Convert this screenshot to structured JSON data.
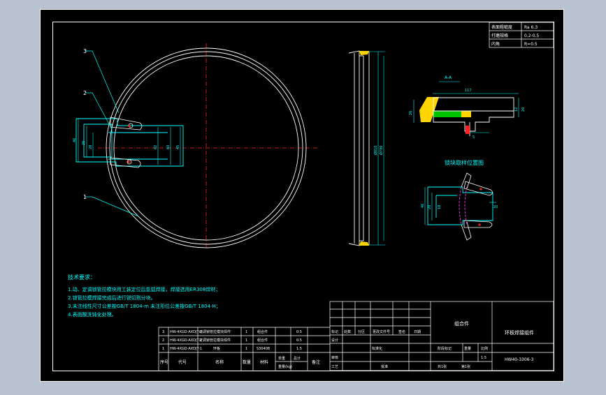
{
  "roughness_table": {
    "rows": [
      [
        "表面粗糙度",
        "Ra 6.3"
      ],
      [
        "打磨规格",
        "0.2-0.5"
      ],
      [
        "内角",
        "R=0.5"
      ]
    ]
  },
  "front_view": {
    "part_labels": [
      "3",
      "2",
      "1"
    ],
    "dimension_labels": [
      "46",
      "26",
      "28",
      "62",
      "60",
      "45"
    ]
  },
  "side_view": {
    "dimension_labels": [
      "Ø810",
      "Ø790"
    ]
  },
  "section": {
    "title": "A-A",
    "dimension_labels": [
      "117",
      "26",
      "12",
      "5",
      "20"
    ]
  },
  "block_view": {
    "title": "锁块取样位置图",
    "dimension_labels": [
      "46",
      "28",
      "18",
      "20"
    ]
  },
  "notes": {
    "heading": "技术要求：",
    "lines": [
      "1.动、定调锁管拉模块用工装定位后氩弧焊接，焊接选用ER308焊材；",
      "2.锁管拉模焊接完成后进行锐切割分块。",
      "3.未注线性尺寸公差按GB/T 1804-m 未注形位公差按GB/T 1804-H；",
      "4.表面酸洗钝化处理。"
    ]
  },
  "bom": {
    "rows": [
      [
        "3",
        "HW-4XGD-AXDJT-3",
        "动调锁管拉模块焊件",
        "1",
        "组合件",
        "",
        "0.5",
        ""
      ],
      [
        "2",
        "HW-4XGD-AXDJT-2",
        "定调锁管拉模块焊件",
        "1",
        "组合件",
        "",
        "0.5",
        ""
      ],
      [
        "1",
        "HW-4XGD-AXDJT-1",
        "环板",
        "1",
        "S30408",
        "",
        "1.5",
        ""
      ]
    ],
    "header": [
      "序号",
      "代号",
      "名称",
      "数量",
      "材料",
      "单重",
      "总计",
      "备注"
    ],
    "weight_label": "重量(kg)"
  },
  "title_block": {
    "unit_label": "组合件",
    "part_name": "环板焊接组件",
    "drawing_number": "HW40-3306-3",
    "sign_headers": [
      "标记",
      "处数",
      "分区",
      "更改文件号",
      "签名",
      "日期"
    ],
    "roles": [
      "设计",
      "审核",
      "工艺"
    ],
    "standardize": "标准化",
    "approve": "批准",
    "stage_labels": [
      "阶段标记",
      "重量",
      "比例"
    ],
    "scale": "1:5",
    "sheet": "共1张",
    "sheet_no": "第1张"
  }
}
